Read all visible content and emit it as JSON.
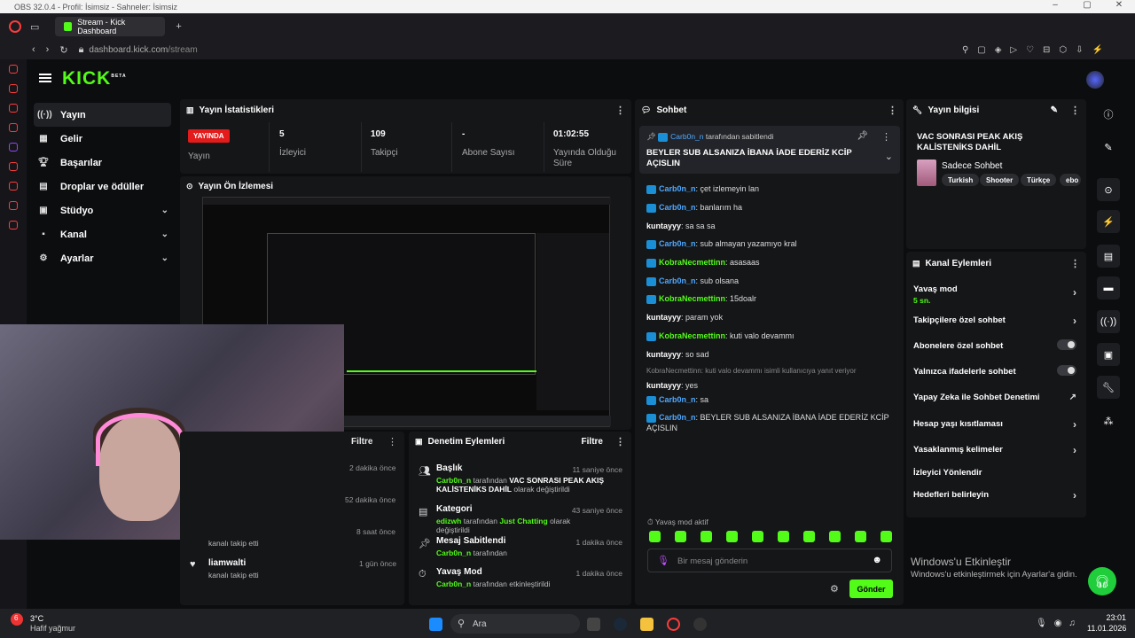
{
  "obs_title": "OBS 32.0.4 - Profil: İsimsiz - Sahneler: İsimsiz",
  "browser": {
    "tab_title": "Stream - Kick Dashboard",
    "url_host": "dashboard.kick.com",
    "url_path": "/stream"
  },
  "kick": {
    "logo": "KICK",
    "logo_sup": "BETA"
  },
  "nav": {
    "items": [
      {
        "label": "Yayın",
        "icon": "stream-icon",
        "active": true
      },
      {
        "label": "Gelir",
        "icon": "revenue-icon"
      },
      {
        "label": "Başarılar",
        "icon": "trophy-icon"
      },
      {
        "label": "Droplar ve ödüller",
        "icon": "drops-icon"
      },
      {
        "label": "Stüdyo",
        "icon": "studio-icon",
        "expandable": true
      },
      {
        "label": "Kanal",
        "icon": "channel-icon",
        "expandable": true
      },
      {
        "label": "Ayarlar",
        "icon": "gear-icon",
        "expandable": true
      }
    ]
  },
  "stats": {
    "title": "Yayın İstatistikleri",
    "live_badge": "YAYINDA",
    "live_label": "Yayın",
    "viewers_value": "5",
    "viewers_label": "İzleyici",
    "followers_value": "109",
    "followers_label": "Takipçi",
    "subs_value": "-",
    "subs_label": "Abone Sayısı",
    "duration_value": "01:02:55",
    "duration_label": "Yayında Olduğu Süre"
  },
  "preview": {
    "title": "Yayın Ön İzlemesi"
  },
  "followers_panel": {
    "filter": "Filtre",
    "items": [
      {
        "time": "2 dakika önce"
      },
      {
        "time": "52 dakika önce"
      },
      {
        "time": "8 saat önce",
        "action": "kanalı takip etti"
      },
      {
        "name": "liamwalti",
        "action": "kanalı takip etti",
        "time": "1 gün önce"
      }
    ]
  },
  "mod_panel": {
    "title": "Denetim Eylemleri",
    "filter": "Filtre",
    "items": [
      {
        "title": "Başlık",
        "time": "11 saniye önce",
        "user": "Carb0n_n",
        "pre": "tarafından",
        "detail": "VAC SONRASI PEAK AKIŞ KALİSTENİKS DAHİL",
        "post": "olarak değiştirildi"
      },
      {
        "title": "Kategori",
        "time": "43 saniye önce",
        "user": "edizwh",
        "pre": "tarafından",
        "detail": "Just Chatting",
        "post": "olarak değiştirildi"
      },
      {
        "title": "Mesaj Sabitlendi",
        "time": "1 dakika önce",
        "user": "Carb0n_n",
        "pre": "tarafından"
      },
      {
        "title": "Yavaş Mod",
        "time": "1 dakika önce",
        "user": "Carb0n_n",
        "pre": "tarafından etkinleştirildi"
      }
    ]
  },
  "chat": {
    "title": "Sohbet",
    "pinned_by_user": "Carb0n_n",
    "pinned_by_text": "tarafından sabitlendi",
    "pinned_message": "BEYLER SUB ALSANIZA İBANA İADE EDERİZ KCİP AÇISLIN",
    "messages": [
      {
        "user": "Carb0n_n",
        "color": "#4ea8ff",
        "badge": true,
        "text": "çet izlemeyin lan"
      },
      {
        "user": "Carb0n_n",
        "color": "#4ea8ff",
        "badge": true,
        "text": "banlarım ha"
      },
      {
        "user": "kuntayyy",
        "color": "#ffffff",
        "badge": false,
        "text": "sa sa sa"
      },
      {
        "user": "Carb0n_n",
        "color": "#4ea8ff",
        "badge": true,
        "text": "sub almayan yazamıyo kral"
      },
      {
        "user": "KobraNecmettinn",
        "color": "#53fc18",
        "badge": true,
        "text": "asasaas"
      },
      {
        "user": "Carb0n_n",
        "color": "#4ea8ff",
        "badge": true,
        "text": "sub olsana"
      },
      {
        "user": "KobraNecmettinn",
        "color": "#53fc18",
        "badge": true,
        "text": "15doalr"
      },
      {
        "user": "kuntayyy",
        "color": "#ffffff",
        "badge": false,
        "text": "param yok"
      },
      {
        "user": "KobraNecmettinn",
        "color": "#53fc18",
        "badge": true,
        "text": "kuti valo devammı"
      },
      {
        "user": "kuntayyy",
        "color": "#ffffff",
        "badge": false,
        "text": "so sad"
      },
      {
        "user": "kuntayyy",
        "color": "#ffffff",
        "badge": false,
        "text": "yes",
        "reply": "KobraNecmettinn: kuti valo devammı isimli kullanıcıya yanıt veriyor"
      },
      {
        "user": "Carb0n_n",
        "color": "#4ea8ff",
        "badge": true,
        "text": "sa"
      },
      {
        "user": "Carb0n_n",
        "color": "#4ea8ff",
        "badge": true,
        "text": "BEYLER SUB ALSANIZA İBANA İADE EDERİZ KCİP AÇISLIN"
      }
    ],
    "slow_mode_notice": "Yavaş mod aktif",
    "input_placeholder": "Bir mesaj gönderin",
    "send_label": "Gönder"
  },
  "stream_info": {
    "title": "Yayın bilgisi",
    "stream_title": "VAC SONRASI PEAK AKIŞ KALİSTENİKS DAHİL",
    "category": "Sadece Sohbet",
    "tags": [
      "Turkish",
      "Shooter",
      "Türkçe",
      "ebo"
    ]
  },
  "channel_actions": {
    "title": "Kanal Eylemleri",
    "slow_mode": "Yavaş mod",
    "slow_mode_value": "5 sn.",
    "followers_only": "Takipçilere özel sohbet",
    "subs_only": "Abonelere özel sohbet",
    "emotes_only": "Yalnızca ifadelerle sohbet",
    "ai_moderation": "Yapay Zeka ile Sohbet Denetimi",
    "account_age": "Hesap yaşı kısıtlaması",
    "banned_words": "Yasaklanmış kelimeler",
    "raid": "İzleyici Yönlendir",
    "goals": "Hedefleri belirleyin"
  },
  "windows": {
    "activate_title": "Windows'u Etkinleştir",
    "activate_sub": "Windows'u etkinleştirmek için Ayarlar'a gidin.",
    "weather_temp": "3°C",
    "weather_desc": "Hafif yağmur",
    "search": "Ara",
    "time": "23:01",
    "date": "11.01.2026",
    "notif_count": "6"
  },
  "colors": {
    "accent": "#53fc18",
    "live": "#e31b1b",
    "mod_blue": "#4ea8ff"
  }
}
